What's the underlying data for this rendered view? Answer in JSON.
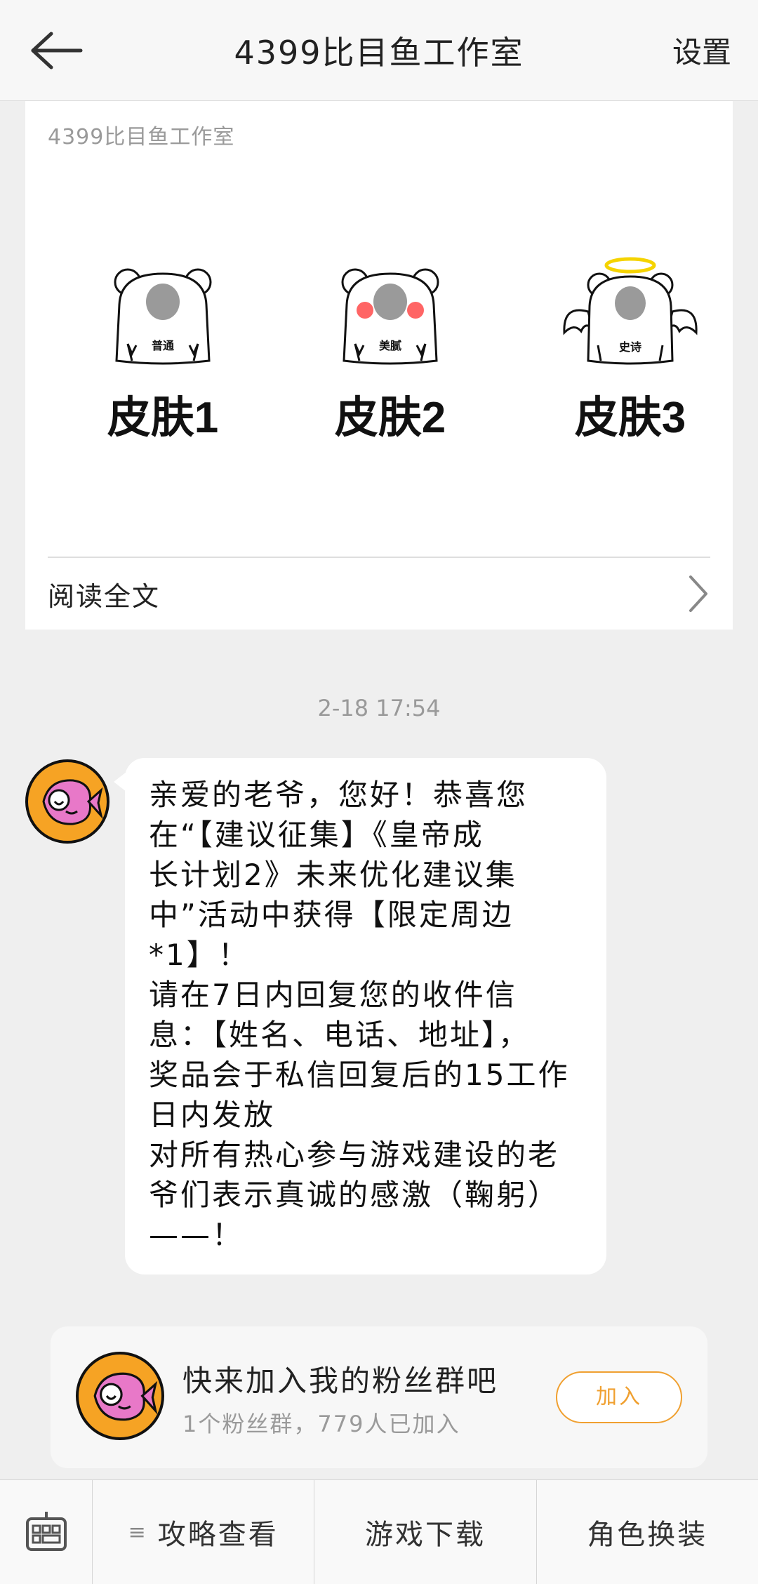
{
  "header": {
    "title": "4399比目鱼工作室",
    "settings_label": "设置"
  },
  "article": {
    "source": "4399比目鱼工作室",
    "skins": [
      {
        "label": "皮肤1",
        "tag": "普通"
      },
      {
        "label": "皮肤2",
        "tag": "美腻"
      },
      {
        "label": "皮肤3",
        "tag": "史诗"
      }
    ],
    "read_full_label": "阅读全文"
  },
  "message": {
    "timestamp": "2-18 17:54",
    "lines": [
      "亲爱的老爷，您好！恭喜您",
      "在“【建议征集】《皇帝成",
      "长计划2》未来优化建议集",
      "中”活动中获得【限定周边",
      "*1】！",
      "请在7日内回复您的收件信",
      "息：【姓名、电话、地址】，",
      "奖品会于私信回复后的15工作",
      "日内发放",
      "对所有热心参与游戏建设的老",
      "爷们表示真诚的感激（鞠躬）",
      "——！"
    ]
  },
  "fan_group": {
    "title": "快来加入我的粉丝群吧",
    "subtitle": "1个粉丝群，779人已加入",
    "join_label": "加入"
  },
  "bottom_bar": {
    "menu_icon_glyph": "≡",
    "items": [
      "攻略查看",
      "游戏下载",
      "角色换装"
    ]
  },
  "icons": {
    "back": "arrow-left-icon",
    "chevron": "chevron-right-icon",
    "keyboard": "keyboard-icon",
    "menu": "menu-icon"
  },
  "colors": {
    "accent": "#f0a030",
    "avatar_bg": "#f6a324",
    "fish": "#e878c8"
  }
}
